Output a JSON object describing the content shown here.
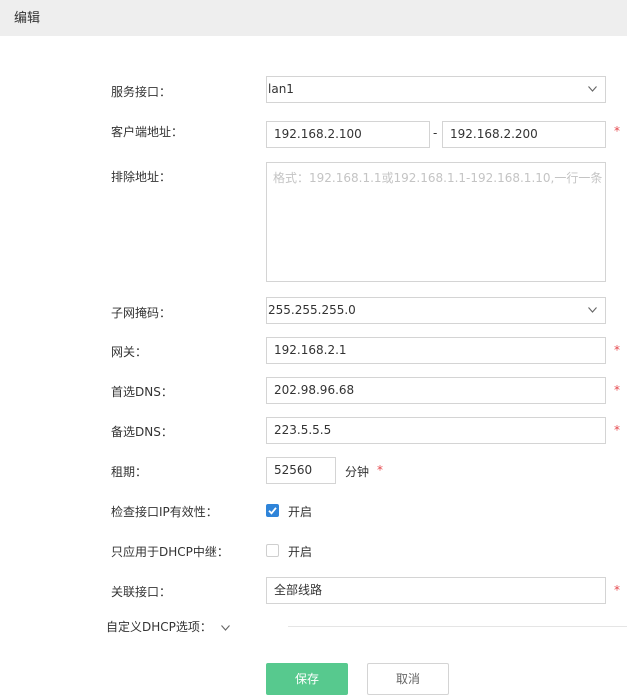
{
  "header": {
    "title": "编辑"
  },
  "form": {
    "service_interface": {
      "label": "服务接口：",
      "value": "lan1"
    },
    "client_address": {
      "label": "客户端地址：",
      "start": "192.168.2.100",
      "separator": "-",
      "end": "192.168.2.200"
    },
    "exclude_address": {
      "label": "排除地址：",
      "placeholder": "格式：192.168.1.1或192.168.1.1-192.168.1.10,一行一条"
    },
    "subnet_mask": {
      "label": "子网掩码：",
      "value": "255.255.255.0"
    },
    "gateway": {
      "label": "网关：",
      "value": "192.168.2.1"
    },
    "primary_dns": {
      "label": "首选DNS：",
      "value": "202.98.96.68"
    },
    "secondary_dns": {
      "label": "备选DNS：",
      "value": "223.5.5.5"
    },
    "lease": {
      "label": "租期：",
      "value": "52560",
      "unit": "分钟"
    },
    "check_ip_validity": {
      "label": "检查接口IP有效性：",
      "option": "开启",
      "checked": true
    },
    "dhcp_relay_only": {
      "label": "只应用于DHCP中继：",
      "option": "开启",
      "checked": false
    },
    "linked_interface": {
      "label": "关联接口：",
      "value": "全部线路"
    },
    "custom_dhcp_options": {
      "label": "自定义DHCP选项："
    },
    "required_mark": "*"
  },
  "buttons": {
    "save": "保存",
    "cancel": "取消"
  },
  "colors": {
    "accent_green": "#57c98e",
    "checkbox_blue": "#2f84d9",
    "required_red": "#e5484d"
  }
}
